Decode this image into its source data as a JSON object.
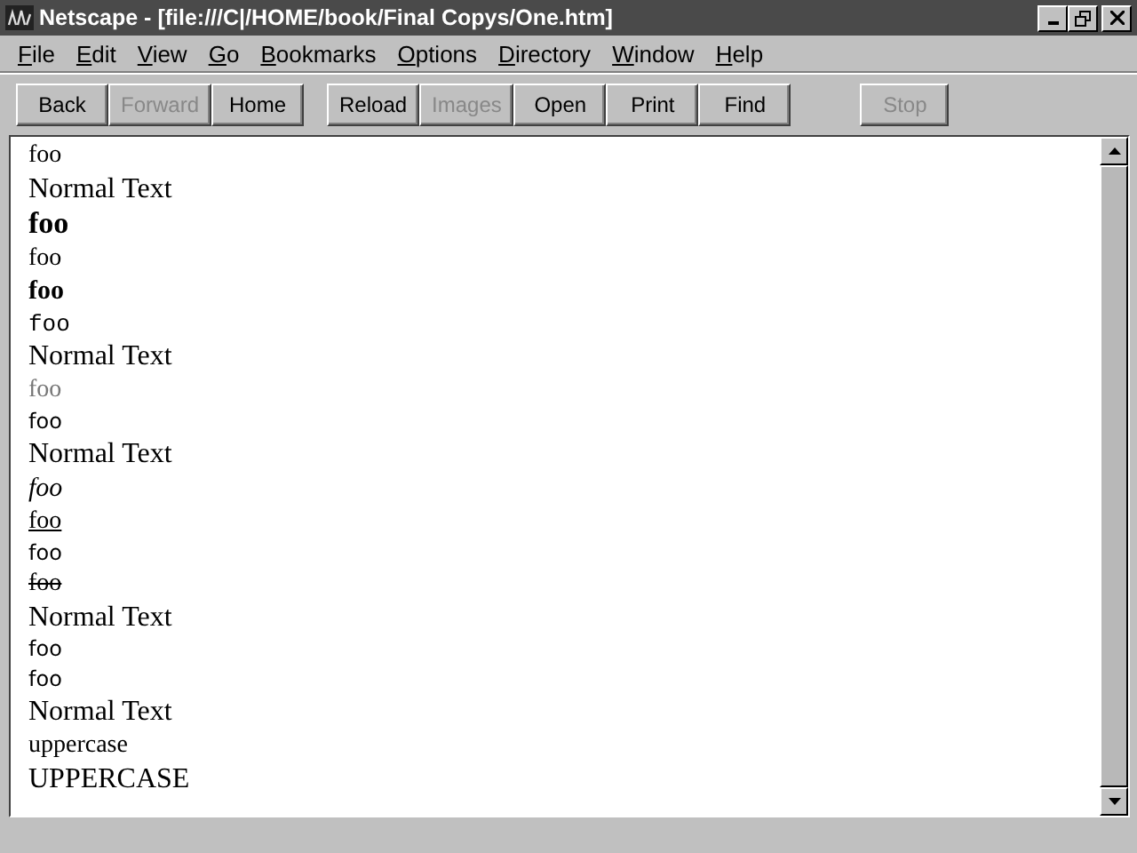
{
  "window": {
    "title": "Netscape - [file:///C|/HOME/book/Final Copys/One.htm]"
  },
  "menu": [
    {
      "key": "F",
      "rest": "ile"
    },
    {
      "key": "E",
      "rest": "dit"
    },
    {
      "key": "V",
      "rest": "iew"
    },
    {
      "key": "G",
      "rest": "o"
    },
    {
      "key": "B",
      "rest": "ookmarks"
    },
    {
      "key": "O",
      "rest": "ptions"
    },
    {
      "key": "D",
      "rest": "irectory"
    },
    {
      "key": "W",
      "rest": "indow"
    },
    {
      "key": "H",
      "rest": "elp"
    }
  ],
  "toolbar": [
    [
      {
        "label": "Back",
        "disabled": false
      },
      {
        "label": "Forward",
        "disabled": true
      },
      {
        "label": "Home",
        "disabled": false
      }
    ],
    [
      {
        "label": "Reload",
        "disabled": false
      },
      {
        "label": "Images",
        "disabled": true
      },
      {
        "label": "Open",
        "disabled": false
      },
      {
        "label": "Print",
        "disabled": false
      },
      {
        "label": "Find",
        "disabled": false
      }
    ],
    [
      {
        "label": "Stop",
        "disabled": true
      }
    ]
  ],
  "content": [
    {
      "text": "foo",
      "kind": "small-serif"
    },
    {
      "text": "Normal Text",
      "kind": "normal"
    },
    {
      "text": "foo",
      "kind": "large-bold"
    },
    {
      "text": "foo",
      "kind": "small-serif"
    },
    {
      "text": "foo",
      "kind": "bold"
    },
    {
      "text": "foo",
      "kind": "mono"
    },
    {
      "text": "Normal Text",
      "kind": "normal"
    },
    {
      "text": "foo",
      "kind": "gray"
    },
    {
      "text": "foo",
      "kind": "sans"
    },
    {
      "text": "Normal Text",
      "kind": "normal"
    },
    {
      "text": "foo",
      "kind": "italic"
    },
    {
      "text": "foo",
      "kind": "underline"
    },
    {
      "text": "foo",
      "kind": "sans"
    },
    {
      "text": "foo",
      "kind": "strike"
    },
    {
      "text": "Normal Text",
      "kind": "normal"
    },
    {
      "text": "foo",
      "kind": "sans"
    },
    {
      "text": "foo",
      "kind": "sans"
    },
    {
      "text": "Normal Text",
      "kind": "normal"
    },
    {
      "text": "uppercase",
      "kind": "small-serif"
    },
    {
      "text": "UPPERCASE",
      "kind": "normal"
    }
  ]
}
